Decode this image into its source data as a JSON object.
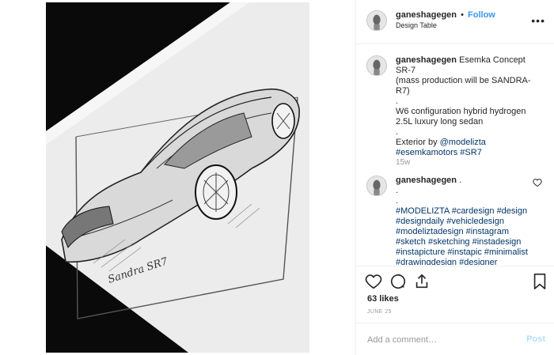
{
  "post": {
    "username": "ganeshagegen",
    "separator": "•",
    "follow_label": "Follow",
    "location": "Design Table",
    "more_label": "•••",
    "photo_alt": "",
    "photo_signature": "Sandra SR7"
  },
  "caption": {
    "username": "ganeshagegen",
    "title": "Esemka Concept SR-7",
    "line2": "(mass production will be SANDRA-R7)",
    "dot1": ".",
    "line3": "W6 configuration hybrid hydrogen 2.5L luxury long sedan",
    "dot2": ".",
    "exterior_prefix": "Exterior by",
    "exterior_mention": "@modelizta",
    "tags": "#esemkamotors #SR7",
    "time": "15w"
  },
  "comment2": {
    "username": "ganeshagegen",
    "first": ".",
    "dots": [
      ".",
      "."
    ],
    "tag_lines": [
      "#MODELIZTA #cardesign #design",
      "#designdaily #vehicledesign",
      "#modeliztadesign #instagram",
      "#sketch #sketching #instadesign",
      "#instapicture #instapic #minimalist",
      "#drawingdesign #designer"
    ]
  },
  "actions": {
    "like_icon": "heart-icon",
    "comment_icon": "comment-icon",
    "share_icon": "share-icon",
    "save_icon": "bookmark-icon"
  },
  "likes": "63 likes",
  "date": "JUNE 25",
  "add_comment": {
    "placeholder": "Add a comment…",
    "post_label": "Post"
  },
  "colors": {
    "link": "#3897f0",
    "hashtag": "#003569",
    "post_disabled": "#b2dffc",
    "muted": "#999999"
  }
}
